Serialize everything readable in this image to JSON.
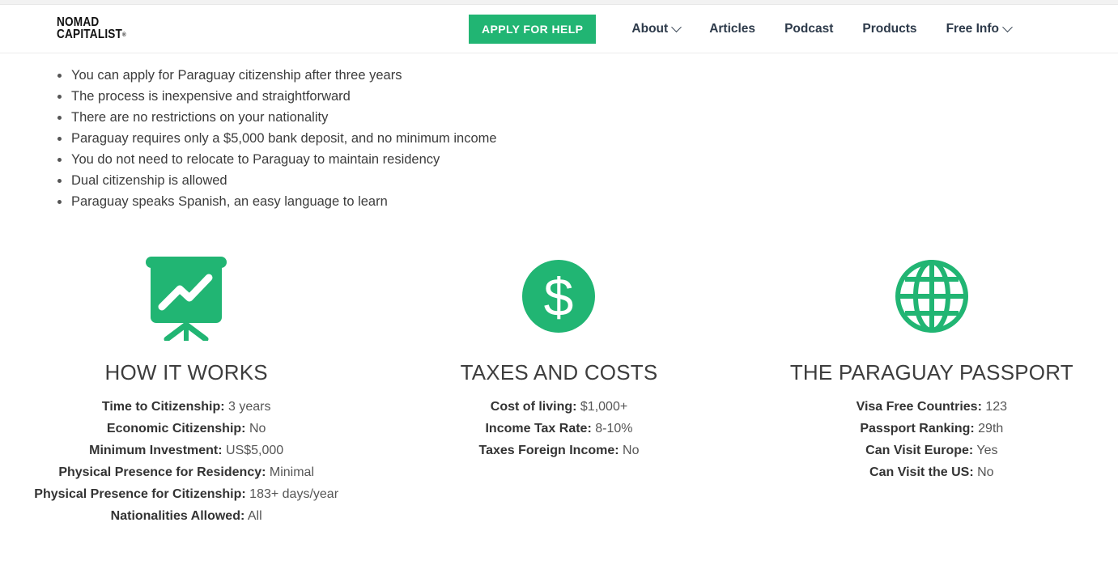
{
  "brand": {
    "logo_line1": "NOMAD",
    "logo_line2": "CAPITALIST",
    "logo_reg": "®",
    "accent_green": "#21b573",
    "text_dark": "#2d3a4a",
    "body_text": "#3c3c3c"
  },
  "header": {
    "apply_label": "APPLY FOR HELP",
    "nav": [
      {
        "label": "About",
        "has_chevron": true
      },
      {
        "label": "Articles",
        "has_chevron": false
      },
      {
        "label": "Podcast",
        "has_chevron": false
      },
      {
        "label": "Products",
        "has_chevron": false
      },
      {
        "label": "Free Info",
        "has_chevron": true
      }
    ]
  },
  "bullets": [
    "You can apply for Paraguay citizenship after three years",
    "The process is inexpensive and straightforward",
    "There are no restrictions on your nationality",
    "Paraguay requires only a $5,000 bank deposit, and no minimum income",
    "You do not need to relocate to Paraguay to maintain residency",
    "Dual citizenship is allowed",
    "Paraguay speaks Spanish, an easy language to learn"
  ],
  "columns": [
    {
      "icon": "presentation-chart-icon",
      "title": "HOW IT WORKS",
      "facts": [
        {
          "label": "Time to Citizenship:",
          "value": "3 years"
        },
        {
          "label": "Economic Citizenship:",
          "value": "No"
        },
        {
          "label": "Minimum Investment:",
          "value": "US$5,000"
        },
        {
          "label": "Physical Presence for Residency:",
          "value": "Minimal"
        },
        {
          "label": "Physical Presence for Citizenship:",
          "value": "183+ days/year"
        },
        {
          "label": "Nationalities Allowed:",
          "value": "All"
        }
      ]
    },
    {
      "icon": "dollar-circle-icon",
      "title": "TAXES AND COSTS",
      "facts": [
        {
          "label": "Cost of living:",
          "value": "$1,000+"
        },
        {
          "label": "Income Tax Rate:",
          "value": "8-10%"
        },
        {
          "label": "Taxes Foreign Income:",
          "value": "No"
        }
      ]
    },
    {
      "icon": "globe-icon",
      "title": "THE PARAGUAY PASSPORT",
      "facts": [
        {
          "label": "Visa Free Countries:",
          "value": "123"
        },
        {
          "label": "Passport Ranking:",
          "value": "29th"
        },
        {
          "label": "Can Visit Europe:",
          "value": "Yes"
        },
        {
          "label": "Can Visit the US:",
          "value": "No"
        }
      ]
    }
  ]
}
